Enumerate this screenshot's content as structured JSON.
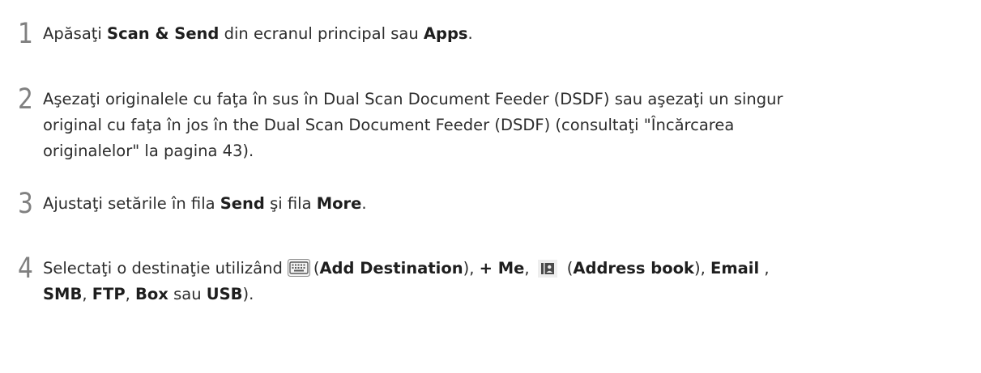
{
  "steps": [
    {
      "number": "1",
      "lines": [
        {
          "parts": [
            {
              "text": "Apăsaţi "
            },
            {
              "text": "Scan & Send",
              "bold": true
            },
            {
              "text": " din ecranul principal sau "
            },
            {
              "text": "Apps",
              "bold": true
            },
            {
              "text": "."
            }
          ]
        }
      ]
    },
    {
      "number": "2",
      "lines": [
        "Aşezaţi originalele cu faţa în sus în Dual Scan Document Feeder (DSDF) sau aşezaţi un singur",
        "original cu faţa în jos în the Dual Scan Document Feeder (DSDF) (consultaţi \"Încărcarea",
        "originalelor\" la pagina 43)."
      ]
    },
    {
      "number": "3",
      "parts": [
        {
          "text": "Ajustaţi setările în fila "
        },
        {
          "text": "Send",
          "bold": true
        },
        {
          "text": " şi fila "
        },
        {
          "text": "More",
          "bold": true
        },
        {
          "text": "."
        }
      ]
    },
    {
      "number": "4",
      "line1": {
        "before_keyboard": "Selectaţi o destinaţie utilizând",
        "add_destination_open": "(",
        "add_destination": "Add Destination",
        "add_destination_close": "), ",
        "me": "+ Me",
        "comma1": ", ",
        "address_open": "(",
        "address_book": "Address book",
        "address_close": "), ",
        "email": "Email",
        "after_email": " ,"
      },
      "line2": {
        "smb": "SMB",
        "c1": ", ",
        "ftp": "FTP",
        "c2": ", ",
        "box": "Box",
        "sau": " sau ",
        "usb": "USB",
        "end": ")."
      }
    }
  ],
  "icons": {
    "keyboard": "keyboard-icon",
    "address_book": "address-book-icon"
  },
  "colors": {
    "text": "#2d2d2d",
    "number": "#555555",
    "icon_gray": "#888888",
    "icon_dark": "#4a4a4a"
  }
}
